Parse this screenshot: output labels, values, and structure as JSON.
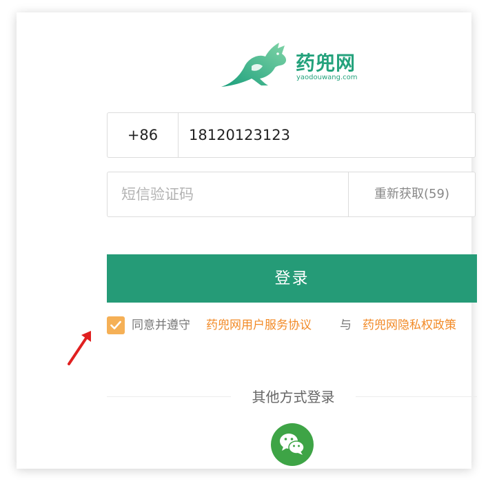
{
  "brand": {
    "name": "药兜网",
    "domain": "yaodouwang.com",
    "color": "#24a27c"
  },
  "phone": {
    "prefix": "+86",
    "value": "18120123123"
  },
  "code": {
    "placeholder": "短信验证码",
    "resend_label": "重新获取(59)"
  },
  "login_button": {
    "label": "登录",
    "color": "#259b77"
  },
  "agreement": {
    "checked": true,
    "prefix_text": "同意并遵守",
    "user_agreement": "药兜网用户服务协议",
    "and_text": "与",
    "privacy_policy": "药兜网隐私权政策",
    "link_color": "#f28a26",
    "checkbox_color": "#f5b056"
  },
  "other_login": {
    "label": "其他方式登录",
    "wechat_icon": "wechat-icon",
    "wechat_color": "#3ea446"
  },
  "annotation": {
    "arrow_icon": "red-arrow-icon",
    "color": "#e02020"
  }
}
